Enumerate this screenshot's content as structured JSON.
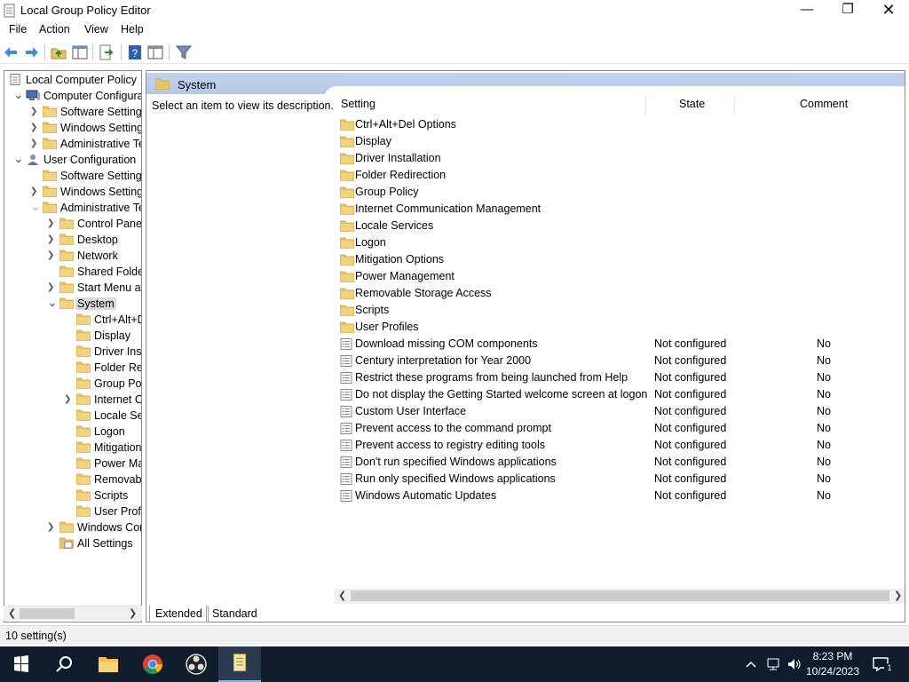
{
  "window": {
    "title": "Local Group Policy Editor",
    "min_glyph": "—",
    "max_glyph": "❐",
    "close_glyph": "✕"
  },
  "menu": [
    "File",
    "Action",
    "View",
    "Help"
  ],
  "tree": [
    {
      "label": "Local Computer Policy",
      "indent": 0,
      "icon": "policy-icon",
      "chevron": ""
    },
    {
      "label": "Computer Configuration",
      "indent": 1,
      "icon": "computer-icon",
      "chevron": "down"
    },
    {
      "label": "Software Settings",
      "indent": 2,
      "icon": "folder-icon",
      "chevron": "right"
    },
    {
      "label": "Windows Settings",
      "indent": 2,
      "icon": "folder-icon",
      "chevron": "right"
    },
    {
      "label": "Administrative Templates",
      "indent": 2,
      "icon": "folder-icon",
      "chevron": "right"
    },
    {
      "label": "User Configuration",
      "indent": 1,
      "icon": "user-icon",
      "chevron": "down"
    },
    {
      "label": "Software Settings",
      "indent": 2,
      "icon": "folder-icon",
      "chevron": ""
    },
    {
      "label": "Windows Settings",
      "indent": 2,
      "icon": "folder-icon",
      "chevron": "right"
    },
    {
      "label": "Administrative Templates",
      "indent": 2,
      "icon": "folder-icon",
      "chevron": "down-blue"
    },
    {
      "label": "Control Panel",
      "indent": 3,
      "icon": "folder-icon",
      "chevron": "right"
    },
    {
      "label": "Desktop",
      "indent": 3,
      "icon": "folder-icon",
      "chevron": "right"
    },
    {
      "label": "Network",
      "indent": 3,
      "icon": "folder-icon",
      "chevron": "right"
    },
    {
      "label": "Shared Folders",
      "indent": 3,
      "icon": "folder-icon",
      "chevron": ""
    },
    {
      "label": "Start Menu and Taskbar",
      "indent": 3,
      "icon": "folder-icon",
      "chevron": "right"
    },
    {
      "label": "System",
      "indent": 3,
      "icon": "folder-icon",
      "chevron": "down",
      "selected": true
    },
    {
      "label": "Ctrl+Alt+Del Options",
      "indent": 4,
      "icon": "folder-icon",
      "chevron": ""
    },
    {
      "label": "Display",
      "indent": 4,
      "icon": "folder-icon",
      "chevron": ""
    },
    {
      "label": "Driver Installation",
      "indent": 4,
      "icon": "folder-icon",
      "chevron": ""
    },
    {
      "label": "Folder Redirection",
      "indent": 4,
      "icon": "folder-icon",
      "chevron": ""
    },
    {
      "label": "Group Policy",
      "indent": 4,
      "icon": "folder-icon",
      "chevron": ""
    },
    {
      "label": "Internet Communication Management",
      "indent": 4,
      "icon": "folder-icon",
      "chevron": "right"
    },
    {
      "label": "Locale Services",
      "indent": 4,
      "icon": "folder-icon",
      "chevron": ""
    },
    {
      "label": "Logon",
      "indent": 4,
      "icon": "folder-icon",
      "chevron": ""
    },
    {
      "label": "Mitigation Options",
      "indent": 4,
      "icon": "folder-icon",
      "chevron": ""
    },
    {
      "label": "Power Management",
      "indent": 4,
      "icon": "folder-icon",
      "chevron": ""
    },
    {
      "label": "Removable Storage Access",
      "indent": 4,
      "icon": "folder-icon",
      "chevron": ""
    },
    {
      "label": "Scripts",
      "indent": 4,
      "icon": "folder-icon",
      "chevron": ""
    },
    {
      "label": "User Profiles",
      "indent": 4,
      "icon": "folder-icon",
      "chevron": ""
    },
    {
      "label": "Windows Components",
      "indent": 3,
      "icon": "folder-icon",
      "chevron": "right"
    },
    {
      "label": "All Settings",
      "indent": 3,
      "icon": "all-settings-icon",
      "chevron": ""
    }
  ],
  "right": {
    "header_title": "System",
    "description": "Select an item to view its description.",
    "columns": {
      "setting": "Setting",
      "state": "State",
      "comment": "Comment"
    },
    "rows": [
      {
        "name": "Ctrl+Alt+Del Options",
        "type": "folder",
        "state": "",
        "comment": ""
      },
      {
        "name": "Display",
        "type": "folder",
        "state": "",
        "comment": ""
      },
      {
        "name": "Driver Installation",
        "type": "folder",
        "state": "",
        "comment": ""
      },
      {
        "name": "Folder Redirection",
        "type": "folder",
        "state": "",
        "comment": ""
      },
      {
        "name": "Group Policy",
        "type": "folder",
        "state": "",
        "comment": ""
      },
      {
        "name": "Internet Communication Management",
        "type": "folder",
        "state": "",
        "comment": ""
      },
      {
        "name": "Locale Services",
        "type": "folder",
        "state": "",
        "comment": ""
      },
      {
        "name": "Logon",
        "type": "folder",
        "state": "",
        "comment": ""
      },
      {
        "name": "Mitigation Options",
        "type": "folder",
        "state": "",
        "comment": ""
      },
      {
        "name": "Power Management",
        "type": "folder",
        "state": "",
        "comment": ""
      },
      {
        "name": "Removable Storage Access",
        "type": "folder",
        "state": "",
        "comment": ""
      },
      {
        "name": "Scripts",
        "type": "folder",
        "state": "",
        "comment": ""
      },
      {
        "name": "User Profiles",
        "type": "folder",
        "state": "",
        "comment": ""
      },
      {
        "name": "Download missing COM components",
        "type": "setting",
        "state": "Not configured",
        "comment": "No"
      },
      {
        "name": "Century interpretation for Year 2000",
        "type": "setting",
        "state": "Not configured",
        "comment": "No"
      },
      {
        "name": "Restrict these programs from being launched from Help",
        "type": "setting",
        "state": "Not configured",
        "comment": "No"
      },
      {
        "name": "Do not display the Getting Started welcome screen at logon",
        "type": "setting",
        "state": "Not configured",
        "comment": "No"
      },
      {
        "name": "Custom User Interface",
        "type": "setting",
        "state": "Not configured",
        "comment": "No"
      },
      {
        "name": "Prevent access to the command prompt",
        "type": "setting",
        "state": "Not configured",
        "comment": "No"
      },
      {
        "name": "Prevent access to registry editing tools",
        "type": "setting",
        "state": "Not configured",
        "comment": "No"
      },
      {
        "name": "Don't run specified Windows applications",
        "type": "setting",
        "state": "Not configured",
        "comment": "No"
      },
      {
        "name": "Run only specified Windows applications",
        "type": "setting",
        "state": "Not configured",
        "comment": "No"
      },
      {
        "name": "Windows Automatic Updates",
        "type": "setting",
        "state": "Not configured",
        "comment": "No"
      }
    ]
  },
  "tabs": {
    "extended": "Extended",
    "standard": "Standard"
  },
  "status": {
    "text": "10 setting(s)"
  },
  "taskbar": {
    "time": "8:23 PM",
    "date": "10/24/2023",
    "notification_count": "1"
  },
  "colors": {
    "folder": "#e8c468",
    "folder_dark": "#d3a537",
    "header": "#bccfe9",
    "taskbar": "#101c2c",
    "accent": "#76b9ed"
  }
}
